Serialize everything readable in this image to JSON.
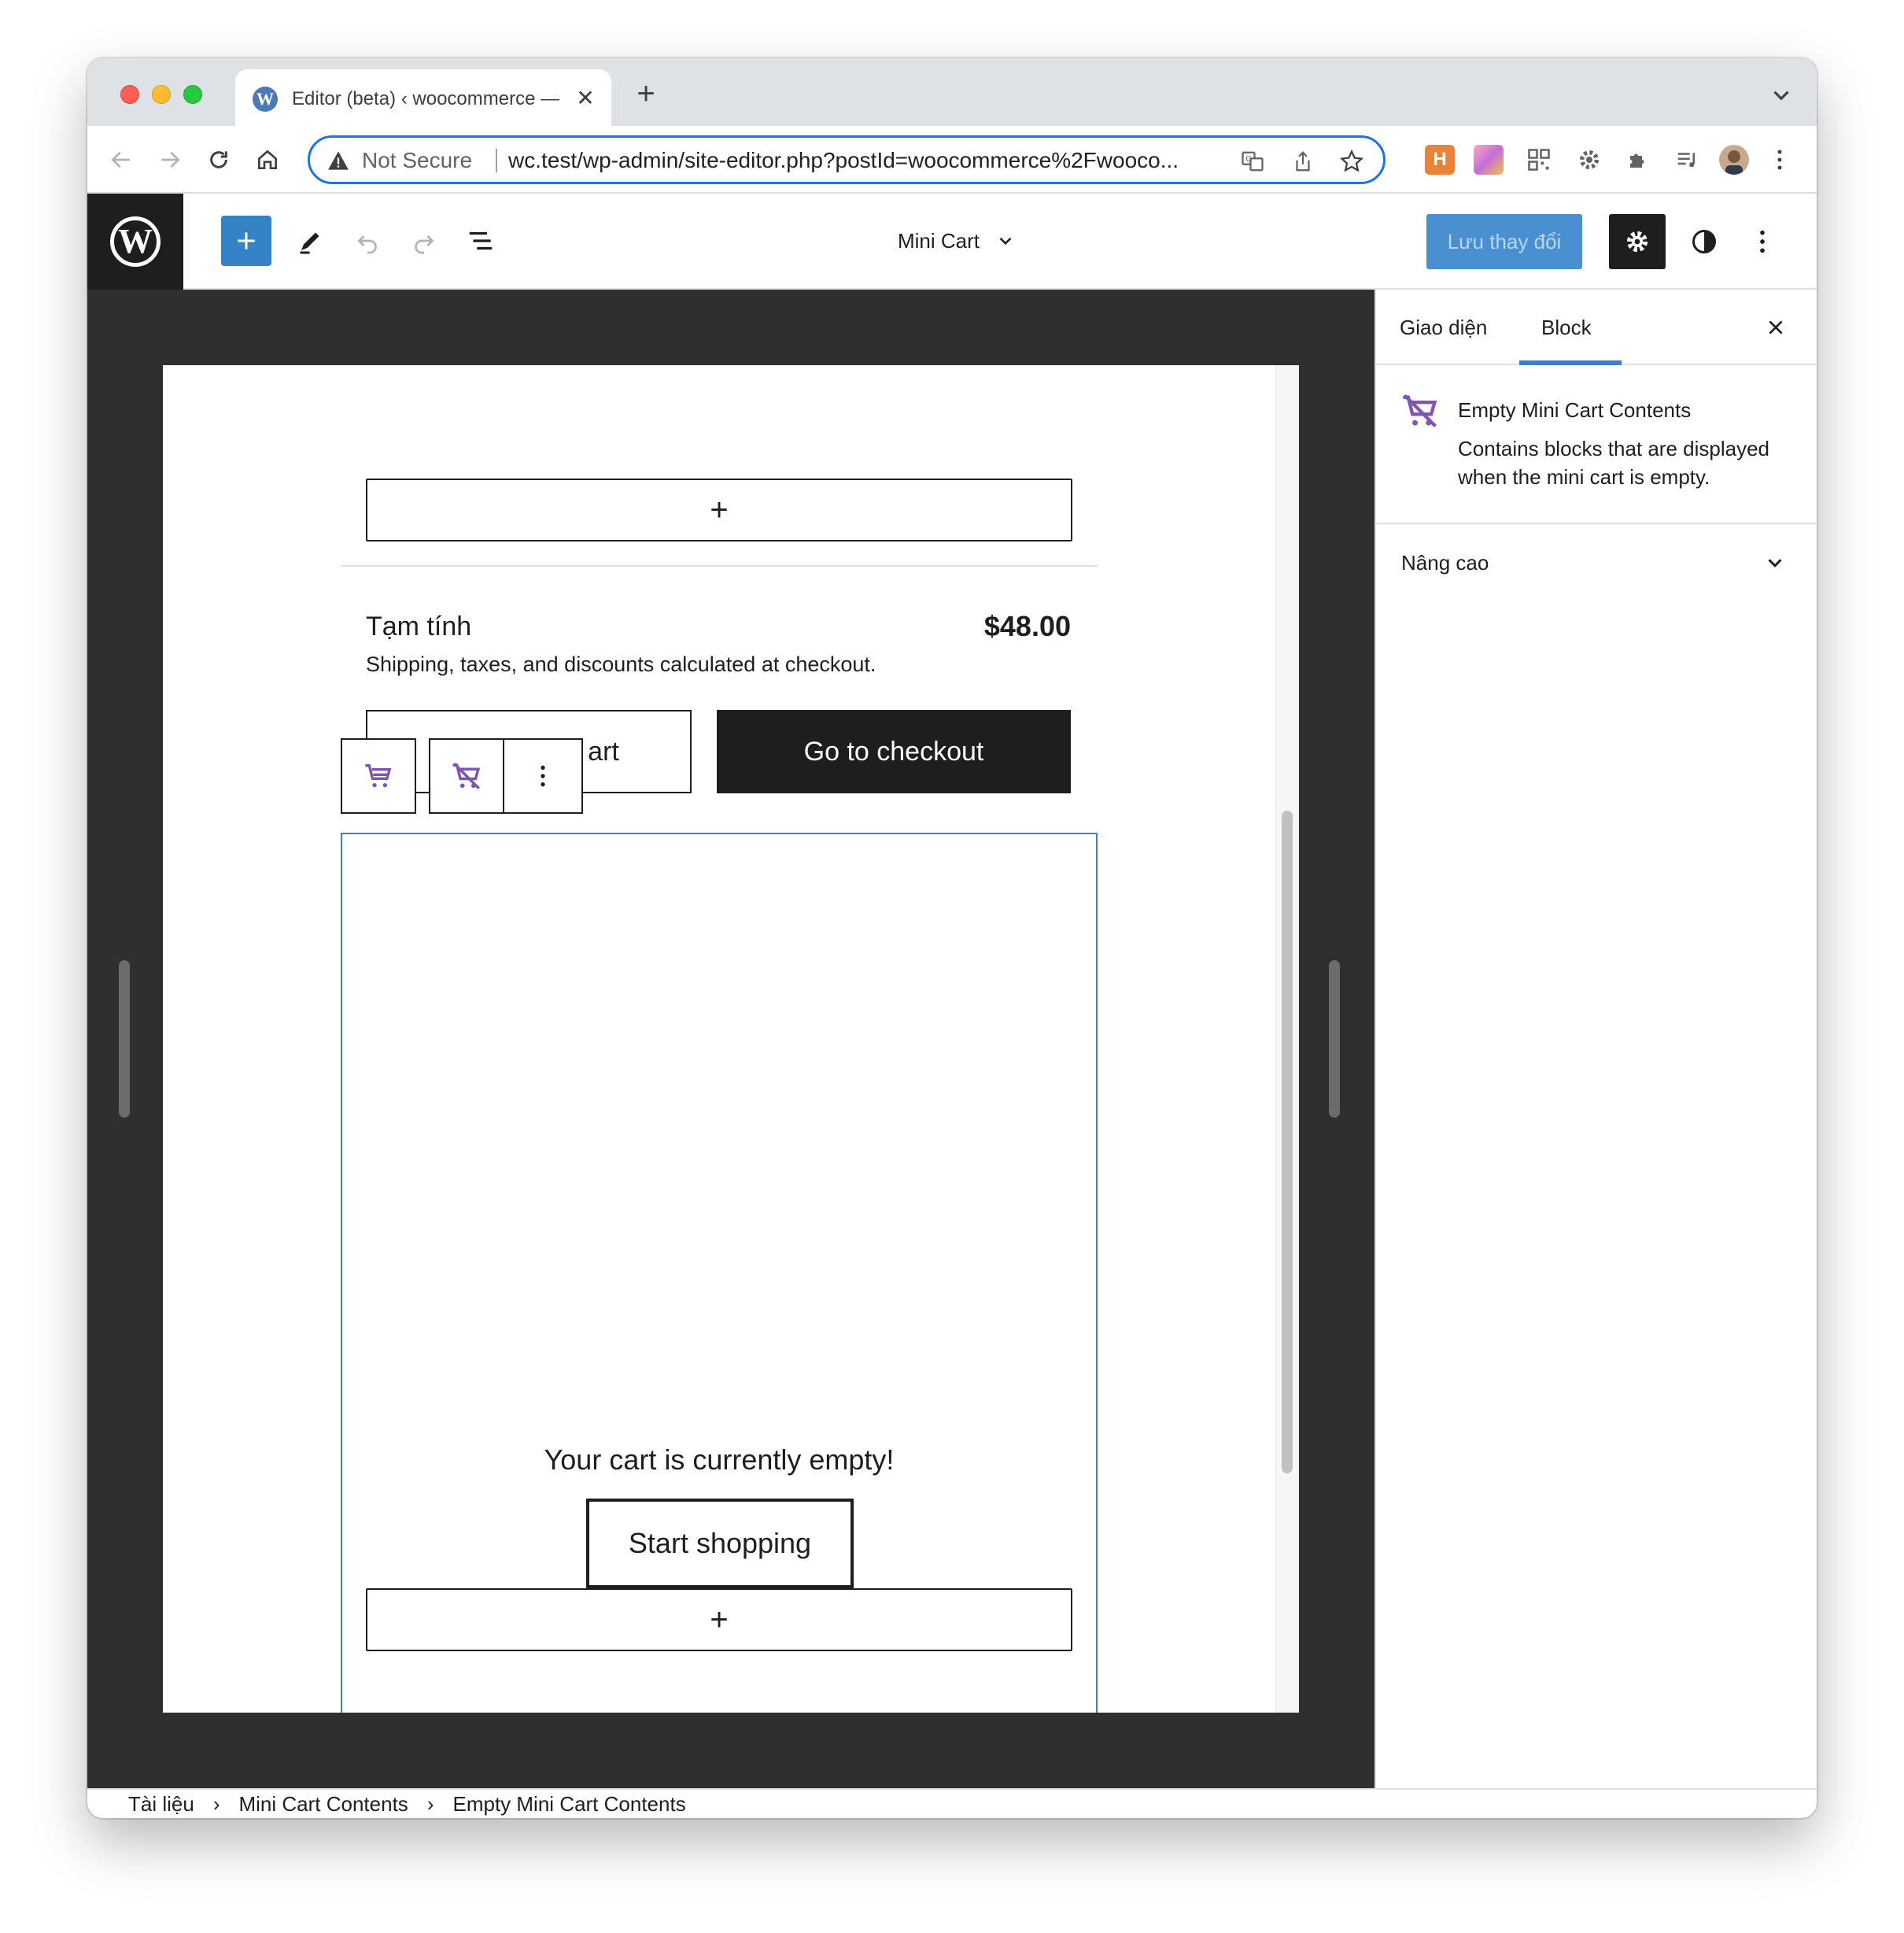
{
  "browser": {
    "tab_title": "Editor (beta) ‹ woocommerce —",
    "security_label": "Not Secure",
    "url": "wc.test/wp-admin/site-editor.php?postId=woocommerce%2Fwooco...",
    "extension_h_label": "H"
  },
  "editor": {
    "document_title": "Mini Cart",
    "save_label": "Lưu thay đổi"
  },
  "canvas": {
    "subtotal_label": "Tạm tính",
    "subtotal_value": "$48.00",
    "subtotal_note": "Shipping, taxes, and discounts calculated at checkout.",
    "view_cart_label": "art",
    "checkout_label": "Go to checkout",
    "empty_message": "Your cart is currently empty!",
    "start_shopping_label": "Start shopping",
    "appender_symbol": "+"
  },
  "sidebar": {
    "tabs": [
      {
        "label": "Giao diện",
        "active": false
      },
      {
        "label": "Block",
        "active": true
      }
    ],
    "block_title": "Empty Mini Cart Contents",
    "block_description": "Contains blocks that are displayed when the mini cart is empty.",
    "advanced_label": "Nâng cao"
  },
  "breadcrumb": [
    "Tài liệu",
    "Mini Cart Contents",
    "Empty Mini Cart Contents"
  ],
  "colors": {
    "accent": "#3582c4",
    "woo_purple": "#7f54b3",
    "dark": "#1e1e1e"
  }
}
